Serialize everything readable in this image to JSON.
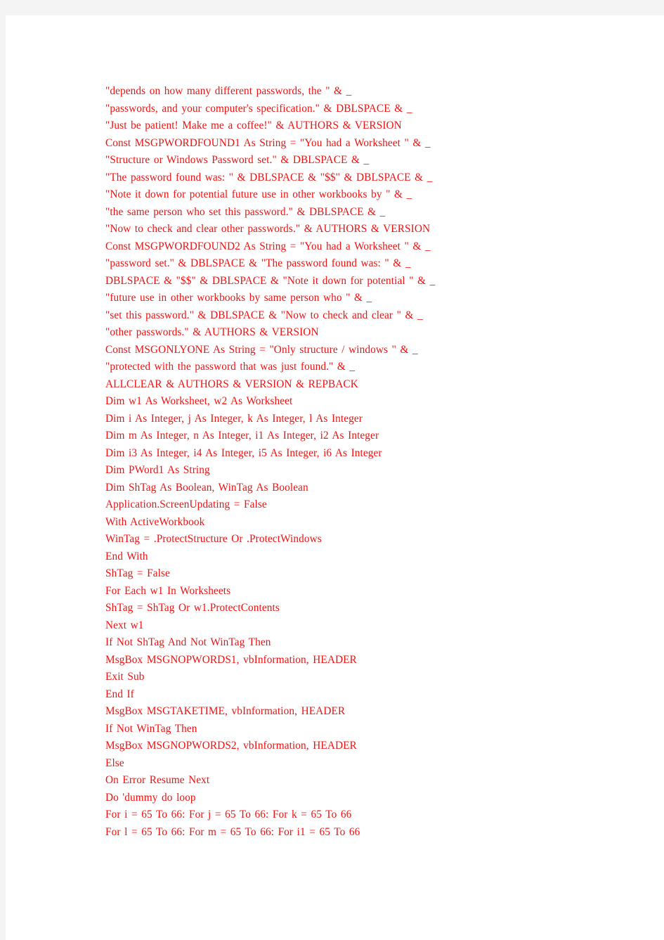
{
  "document": {
    "page_background": "#ffffff",
    "canvas_background": "#f4f4f4",
    "text_color": "#ee1111"
  },
  "code": {
    "language": "VBA",
    "lines": [
      "\"depends on how many different passwords, the \" & _",
      "\"passwords, and your computer's specification.\" & DBLSPACE & _",
      "\"Just be patient! Make me a coffee!\" & AUTHORS & VERSION",
      "Const MSGPWORDFOUND1 As String = \"You had a Worksheet \" & _",
      "\"Structure or Windows Password set.\" & DBLSPACE & _",
      "\"The password found was: \" & DBLSPACE & \"$$\" & DBLSPACE & _",
      "\"Note it down for potential future use in other workbooks by \" & _",
      "\"the same person who set this password.\" & DBLSPACE & _",
      "\"Now to check and clear other passwords.\" & AUTHORS & VERSION",
      "Const MSGPWORDFOUND2 As String = \"You had a Worksheet \" & _",
      "\"password set.\" & DBLSPACE & \"The password found was: \" & _",
      "DBLSPACE & \"$$\" & DBLSPACE & \"Note it down for potential \" & _",
      "\"future use in other workbooks by same person who \" & _",
      "\"set this password.\" & DBLSPACE & \"Now to check and clear \" & _",
      "\"other passwords.\" & AUTHORS & VERSION",
      "Const MSGONLYONE As String = \"Only structure / windows \" & _",
      "\"protected with the password that was just found.\" & _",
      "ALLCLEAR & AUTHORS & VERSION & REPBACK",
      "Dim w1 As Worksheet, w2 As Worksheet",
      "Dim i As Integer, j As Integer, k As Integer, l As Integer",
      "Dim m As Integer, n As Integer, i1 As Integer, i2 As Integer",
      "Dim i3 As Integer, i4 As Integer, i5 As Integer, i6 As Integer",
      "Dim PWord1 As String",
      "Dim ShTag As Boolean, WinTag As Boolean",
      "Application.ScreenUpdating = False",
      "With ActiveWorkbook",
      "WinTag = .ProtectStructure Or .ProtectWindows",
      "End With",
      "ShTag = False",
      "For Each w1 In Worksheets",
      "ShTag = ShTag Or w1.ProtectContents",
      "Next w1",
      "If Not ShTag And Not WinTag Then",
      "MsgBox MSGNOPWORDS1, vbInformation, HEADER",
      "Exit Sub",
      "End If",
      "MsgBox MSGTAKETIME, vbInformation, HEADER",
      "If Not WinTag Then",
      "MsgBox MSGNOPWORDS2, vbInformation, HEADER",
      "Else",
      "On Error Resume Next",
      "Do 'dummy do loop",
      "For i = 65 To 66: For j = 65 To 66: For k = 65 To 66",
      "For l = 65 To 66: For m = 65 To 66: For i1 = 65 To 66"
    ]
  }
}
